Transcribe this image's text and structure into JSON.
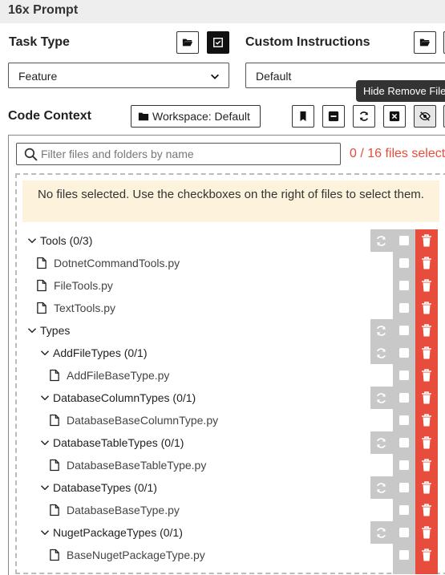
{
  "app": {
    "title": "16x Prompt"
  },
  "task_type": {
    "label": "Task Type",
    "value": "Feature"
  },
  "custom_instructions": {
    "label": "Custom Instructions",
    "value": "Default"
  },
  "tooltip": {
    "text": "Hide Remove File"
  },
  "code_context": {
    "label": "Code Context",
    "workspace_button": "Workspace: Default"
  },
  "filter": {
    "placeholder": "Filter files and folders by name",
    "count_text": "0 / 16 files select"
  },
  "notice": {
    "text": "No files selected. Use the checkboxes on the right of files to select them."
  },
  "colors": {
    "accent_red": "#e74c3c",
    "column_gray": "#c8c8c8",
    "notice_bg": "#fdf3dc"
  },
  "tree": [
    {
      "type": "folder",
      "label": "Tools (0/3)",
      "depth": 0,
      "sync": true
    },
    {
      "type": "file",
      "label": "DotnetCommandTools.py",
      "depth": 1
    },
    {
      "type": "file",
      "label": "FileTools.py",
      "depth": 1
    },
    {
      "type": "file",
      "label": "TextTools.py",
      "depth": 1
    },
    {
      "type": "folder",
      "label": "Types",
      "depth": 0,
      "sync": true
    },
    {
      "type": "folder",
      "label": "AddFileTypes (0/1)",
      "depth": 1,
      "sync": true
    },
    {
      "type": "file",
      "label": "AddFileBaseType.py",
      "depth": 2
    },
    {
      "type": "folder",
      "label": "DatabaseColumnTypes (0/1)",
      "depth": 1,
      "sync": true
    },
    {
      "type": "file",
      "label": "DatabaseBaseColumnType.py",
      "depth": 2
    },
    {
      "type": "folder",
      "label": "DatabaseTableTypes (0/1)",
      "depth": 1,
      "sync": true
    },
    {
      "type": "file",
      "label": "DatabaseBaseTableType.py",
      "depth": 2
    },
    {
      "type": "folder",
      "label": "DatabaseTypes (0/1)",
      "depth": 1,
      "sync": true
    },
    {
      "type": "file",
      "label": "DatabaseBaseType.py",
      "depth": 2
    },
    {
      "type": "folder",
      "label": "NugetPackageTypes (0/1)",
      "depth": 1,
      "sync": true
    },
    {
      "type": "file",
      "label": "BaseNugetPackageType.py",
      "depth": 2
    }
  ]
}
